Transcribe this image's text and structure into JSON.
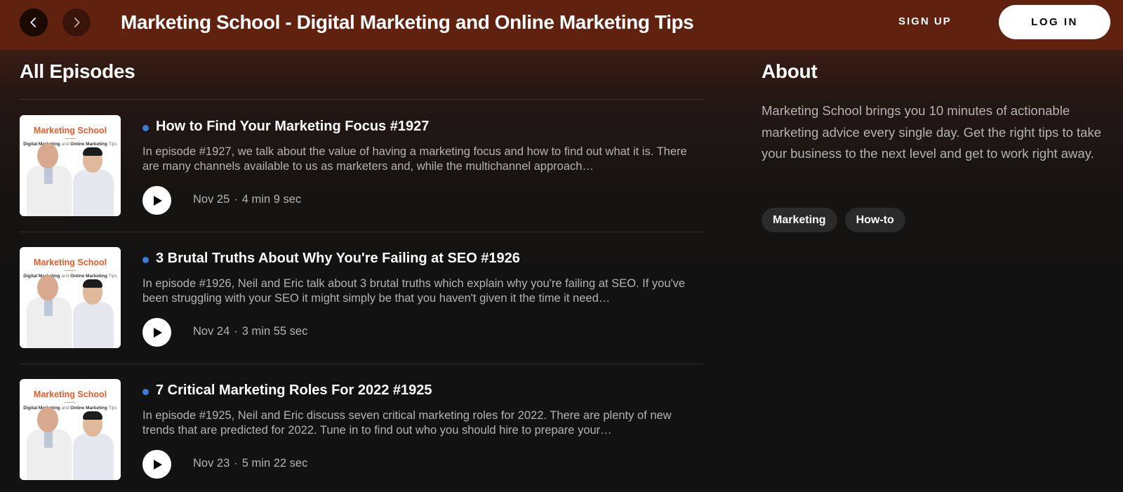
{
  "header": {
    "show_title": "Marketing School - Digital Marketing and Online Marketing Tips",
    "signup_label": "SIGN UP",
    "login_label": "LOG IN",
    "back_icon": "chevron-left-icon",
    "forward_icon": "chevron-right-icon"
  },
  "episodes_section": {
    "title": "All Episodes",
    "cover": {
      "title": "Marketing School",
      "subtitle_a": "Digital Marketing",
      "subtitle_and": "and",
      "subtitle_b": "Online Marketing",
      "subtitle_c": "Tips"
    },
    "items": [
      {
        "title": "How to Find Your Marketing Focus #1927",
        "description": "In episode #1927, we talk about the value of having a marketing focus and how to find out what it is. There are many channels available to us as marketers and, while the multichannel approach…",
        "date": "Nov 25",
        "duration": "4 min 9 sec"
      },
      {
        "title": "3 Brutal Truths About Why You're Failing at SEO #1926",
        "description": "In episode #1926, Neil and Eric talk about 3 brutal truths which explain why you're failing at SEO. If you've been struggling with your SEO it might simply be that you haven't given it the time it need…",
        "date": "Nov 24",
        "duration": "3 min 55 sec"
      },
      {
        "title": "7 Critical Marketing Roles For 2022 #1925",
        "description": "In episode #1925, Neil and Eric discuss seven critical marketing roles for 2022. There are plenty of new trends that are predicted for 2022. Tune in to find out who you should hire to prepare your…",
        "date": "Nov 23",
        "duration": "5 min 22 sec"
      }
    ]
  },
  "about": {
    "title": "About",
    "text": "Marketing School brings you 10 minutes of actionable marketing advice every single day. Get the right tips to take your business to the next level and get to work right away.",
    "tags": [
      "Marketing",
      "How-to"
    ]
  },
  "meta_separator": "·",
  "colors": {
    "header_bg": "#60210f",
    "new_dot": "#3a7bd5",
    "cover_title": "#e85c2c"
  }
}
